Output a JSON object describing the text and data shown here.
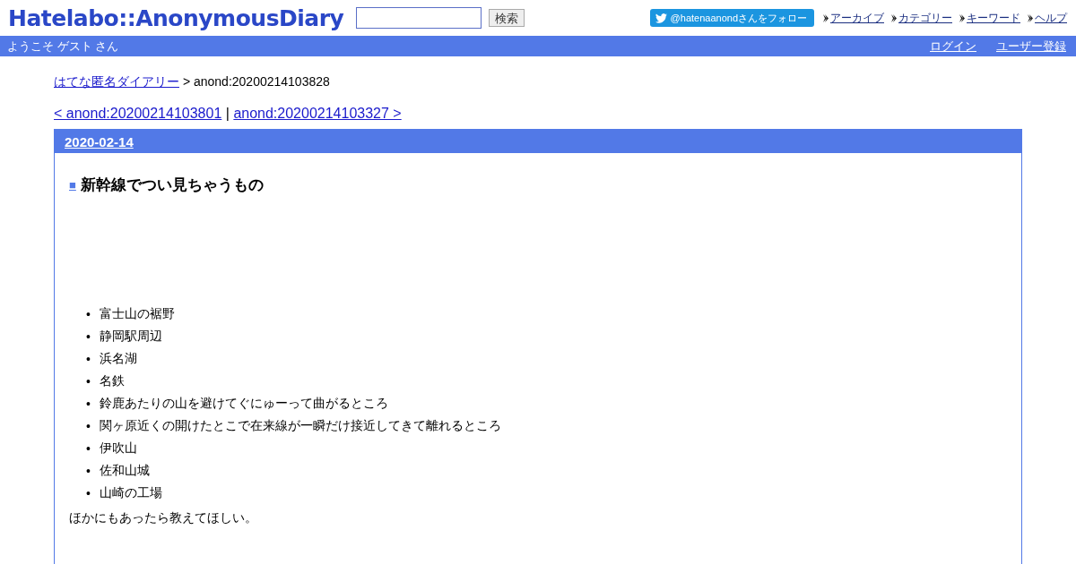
{
  "header": {
    "logo": "Hatelabo::AnonymousDiary",
    "search": {
      "button": "検索"
    },
    "follow_button": "@hatenaanondさんをフォロー",
    "nav_links": [
      "アーカイブ",
      "カテゴリー",
      "キーワード",
      "ヘルプ"
    ]
  },
  "user_bar": {
    "welcome": "ようこそ ゲスト さん",
    "links": [
      "ログイン",
      "ユーザー登録"
    ]
  },
  "breadcrumb": {
    "link": "はてな匿名ダイアリー",
    "current": "> anond:20200214103828"
  },
  "pager": {
    "prev": "< anond:20200214103801",
    "separator": "|",
    "next": "anond:20200214103327 >"
  },
  "day": {
    "date": "2020-02-14",
    "title_mark": "■",
    "title": "新幹線でつい見ちゃうもの",
    "bullet": "•",
    "items": [
      "富士山の裾野",
      "静岡駅周辺",
      "浜名湖",
      "名鉄",
      "鈴鹿あたりの山を避けてぐにゅーって曲がるところ",
      "関ヶ原近くの開けたとこで在来線が一瞬だけ接近してきて離れるところ",
      "伊吹山",
      "佐和山城",
      "山崎の工場"
    ],
    "closing": "ほかにもあったら教えてほしい。"
  }
}
